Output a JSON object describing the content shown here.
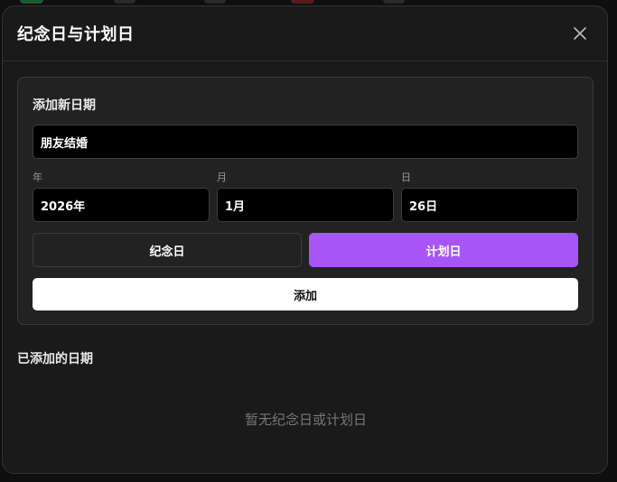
{
  "modal": {
    "title": "纪念日与计划日"
  },
  "form": {
    "section_title": "添加新日期",
    "name_value": "朋友结婚",
    "year_label": "年",
    "month_label": "月",
    "day_label": "日",
    "year_value": "2026年",
    "month_value": "1月",
    "day_value": "26日",
    "type_anniversary_label": "纪念日",
    "type_plan_label": "计划日",
    "selected_type": "计划日",
    "add_label": "添加"
  },
  "list": {
    "section_title": "已添加的日期",
    "empty_text": "暂无纪念日或计划日"
  },
  "colors": {
    "accent": "#a855f7",
    "background": "#1a1a1a",
    "card": "#222222"
  },
  "icons": {
    "close": "close-icon"
  }
}
